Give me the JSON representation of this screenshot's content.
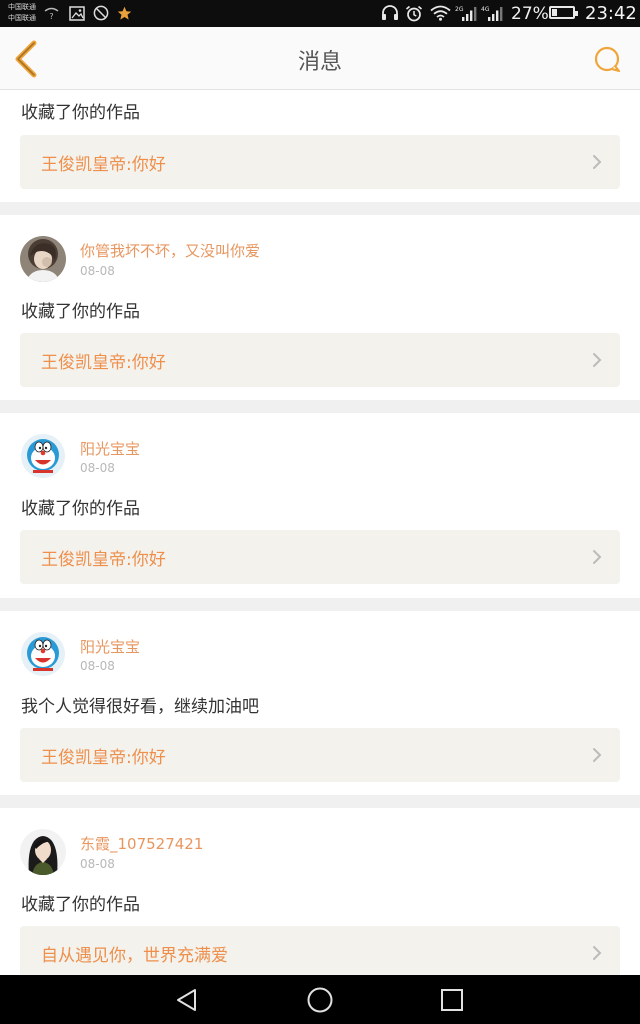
{
  "status_bar": {
    "carrier_1": "中国联通",
    "carrier_2": "中国联通",
    "battery_percent": "27%",
    "battery_level": 0.27,
    "time": "23:42",
    "signal_1_tech": "2G",
    "signal_2_tech": "4G",
    "icons": [
      "wifi-question-icon",
      "image-icon",
      "no-entry-icon",
      "star-icon",
      "headphones-icon",
      "alarm-icon",
      "wifi-icon",
      "signal-icon",
      "signal-icon",
      "battery-icon"
    ]
  },
  "header": {
    "title": "消息",
    "back_icon": "chevron-left-icon",
    "action_icon": "chat-bubble-icon",
    "accent_color": "#f0a53a"
  },
  "colors": {
    "username": "#e8965f",
    "work_title": "#ee8f4c",
    "work_bg": "#f3f2ec",
    "background": "#f0f0f0"
  },
  "messages": [
    {
      "message": "收藏了你的作品",
      "work_title": "王俊凯皇帝:你好"
    },
    {
      "username": "你管我坏不坏，又没叫你爱",
      "date": "08-08",
      "avatar": "avatar-photo",
      "message": "收藏了你的作品",
      "work_title": "王俊凯皇帝:你好"
    },
    {
      "username": "阳光宝宝",
      "date": "08-08",
      "avatar": "avatar-doraemon",
      "message": "收藏了你的作品",
      "work_title": "王俊凯皇帝:你好"
    },
    {
      "username": "阳光宝宝",
      "date": "08-08",
      "avatar": "avatar-doraemon",
      "message": "我个人觉得很好看，继续加油吧",
      "work_title": "王俊凯皇帝:你好"
    },
    {
      "username": "东霞_107527421",
      "date": "08-08",
      "avatar": "avatar-photo",
      "message": "收藏了你的作品",
      "work_title": "自从遇见你，世界充满爱"
    }
  ],
  "nav_bar": {
    "icons": [
      "back-triangle-icon",
      "home-circle-icon",
      "recents-square-icon"
    ]
  }
}
